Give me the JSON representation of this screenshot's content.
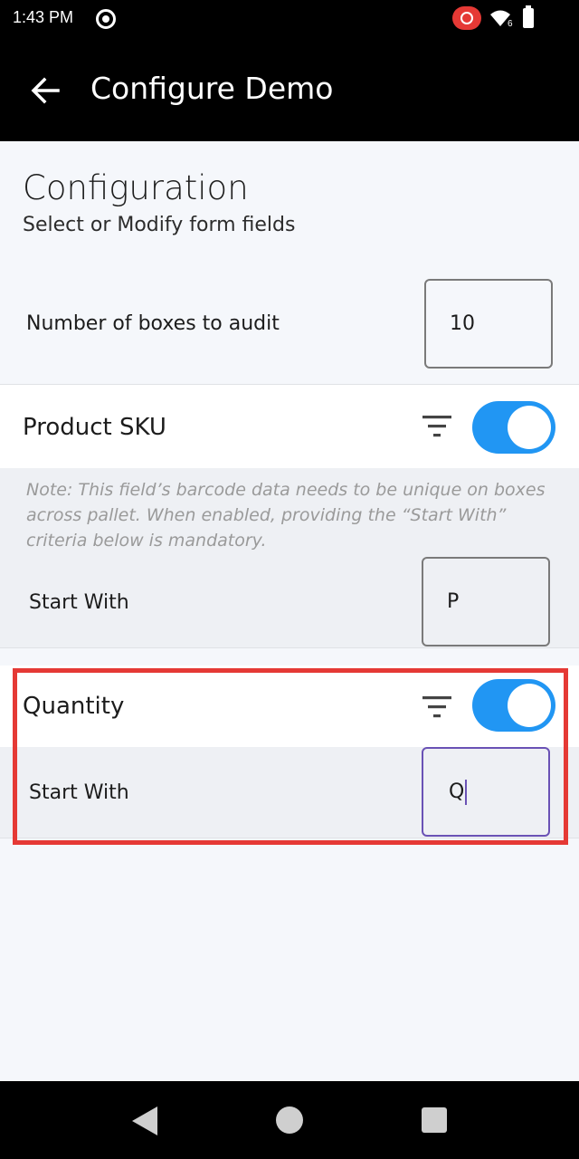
{
  "status_bar": {
    "time": "1:43 PM",
    "wifi_badge": "6"
  },
  "app_bar": {
    "title": "Configure Demo"
  },
  "configuration": {
    "title": "Configuration",
    "subtitle": "Select or Modify form fields",
    "boxes_label": "Number of boxes to audit",
    "boxes_value": "10"
  },
  "product_sku": {
    "label": "Product SKU",
    "enabled": true,
    "note": "Note: This field’s barcode data needs to be unique on boxes across pallet. When enabled, providing the “Start With” criteria below is mandatory.",
    "start_with_label": "Start With",
    "start_with_value": "P"
  },
  "quantity": {
    "label": "Quantity",
    "enabled": true,
    "start_with_label": "Start With",
    "start_with_value": "Q"
  },
  "colors": {
    "toggle_on": "#2196f3",
    "highlight": "#e53935",
    "focus": "#6a52b5"
  }
}
